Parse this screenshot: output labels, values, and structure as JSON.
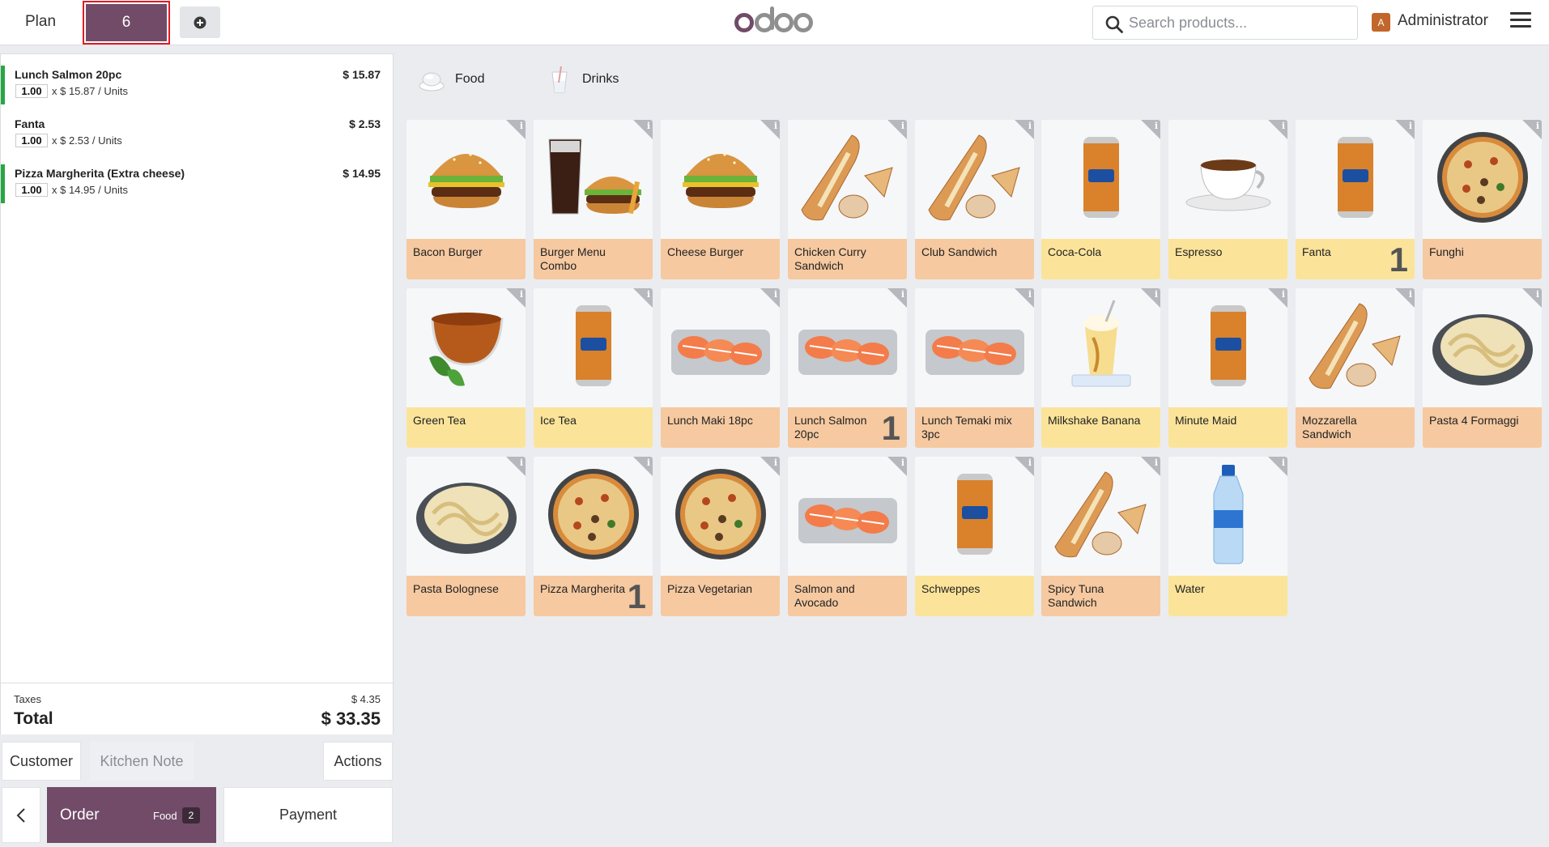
{
  "header": {
    "plan_label": "Plan",
    "table_number": "6",
    "logo_text": "odoo",
    "search_placeholder": "Search products...",
    "user_initial": "A",
    "user_name": "Administrator"
  },
  "orderlines": [
    {
      "name": "Lunch Salmon 20pc",
      "price": "$ 15.87",
      "qty": "1.00",
      "unit": "x $ 15.87 / Units",
      "sent": true
    },
    {
      "name": "Fanta",
      "price": "$ 2.53",
      "qty": "1.00",
      "unit": "x $ 2.53 / Units",
      "sent": false
    },
    {
      "name": "Pizza Margherita (Extra cheese)",
      "price": "$ 14.95",
      "qty": "1.00",
      "unit": "x $ 14.95 / Units",
      "sent": true
    }
  ],
  "summary": {
    "taxes_label": "Taxes",
    "taxes_value": "$ 4.35",
    "total_label": "Total",
    "total_value": "$ 33.35"
  },
  "controls": {
    "customer": "Customer",
    "kitchen_note": "Kitchen Note",
    "actions": "Actions",
    "order_label": "Order",
    "order_category": "Food",
    "order_count": "2",
    "payment": "Payment"
  },
  "categories": [
    {
      "label": "Food",
      "color": "#f6c9a0",
      "icon": "food-icon"
    },
    {
      "label": "Drinks",
      "color": "#fbe49a",
      "icon": "drinks-icon"
    }
  ],
  "colors": {
    "brand": "#714b67",
    "food": "#f6c9a0",
    "drink": "#fbe49a",
    "sent_line": "#28a745"
  },
  "products": [
    {
      "name": "Bacon Burger",
      "type": "food",
      "qty": "",
      "icon": "burger-icon"
    },
    {
      "name": "Burger Menu Combo",
      "type": "food",
      "qty": "",
      "icon": "burger-combo-icon"
    },
    {
      "name": "Cheese Burger",
      "type": "food",
      "qty": "",
      "icon": "burger-icon"
    },
    {
      "name": "Chicken Curry Sandwich",
      "type": "food",
      "qty": "",
      "icon": "sandwich-icon"
    },
    {
      "name": "Club Sandwich",
      "type": "food",
      "qty": "",
      "icon": "sandwich-icon"
    },
    {
      "name": "Coca-Cola",
      "type": "drink",
      "qty": "",
      "icon": "can-icon"
    },
    {
      "name": "Espresso",
      "type": "drink",
      "qty": "",
      "icon": "coffee-cup-icon"
    },
    {
      "name": "Fanta",
      "type": "drink",
      "qty": "1",
      "icon": "can-icon"
    },
    {
      "name": "Funghi",
      "type": "food",
      "qty": "",
      "icon": "pizza-icon"
    },
    {
      "name": "Green Tea",
      "type": "drink",
      "qty": "",
      "icon": "tea-cup-icon"
    },
    {
      "name": "Ice Tea",
      "type": "drink",
      "qty": "",
      "icon": "can-icon"
    },
    {
      "name": "Lunch Maki 18pc",
      "type": "food",
      "qty": "",
      "icon": "sushi-icon"
    },
    {
      "name": "Lunch Salmon 20pc",
      "type": "food",
      "qty": "1",
      "icon": "sushi-icon"
    },
    {
      "name": "Lunch Temaki mix 3pc",
      "type": "food",
      "qty": "",
      "icon": "sushi-icon"
    },
    {
      "name": "Milkshake Banana",
      "type": "drink",
      "qty": "",
      "icon": "milkshake-icon"
    },
    {
      "name": "Minute Maid",
      "type": "drink",
      "qty": "",
      "icon": "can-icon"
    },
    {
      "name": "Mozzarella Sandwich",
      "type": "food",
      "qty": "",
      "icon": "sandwich-icon"
    },
    {
      "name": "Pasta 4 Formaggi",
      "type": "food",
      "qty": "",
      "icon": "pasta-icon"
    },
    {
      "name": "Pasta Bolognese",
      "type": "food",
      "qty": "",
      "icon": "pasta-icon"
    },
    {
      "name": "Pizza Margherita",
      "type": "food",
      "qty": "1",
      "icon": "pizza-icon"
    },
    {
      "name": "Pizza Vegetarian",
      "type": "food",
      "qty": "",
      "icon": "pizza-icon"
    },
    {
      "name": "Salmon and Avocado",
      "type": "food",
      "qty": "",
      "icon": "sushi-icon"
    },
    {
      "name": "Schweppes",
      "type": "drink",
      "qty": "",
      "icon": "can-icon"
    },
    {
      "name": "Spicy Tuna Sandwich",
      "type": "food",
      "qty": "",
      "icon": "sandwich-icon"
    },
    {
      "name": "Water",
      "type": "drink",
      "qty": "",
      "icon": "bottle-icon"
    }
  ]
}
